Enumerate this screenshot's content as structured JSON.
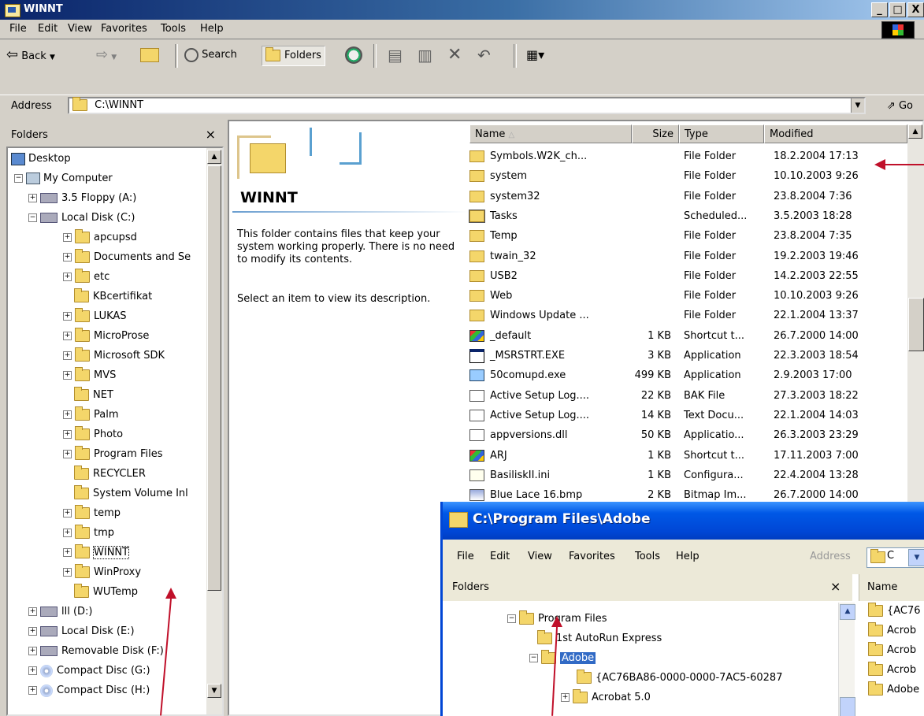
{
  "window": {
    "title": "WINNT",
    "min": "_",
    "max": "□",
    "close": "X"
  },
  "menu": [
    "File",
    "Edit",
    "View",
    "Favorites",
    "Tools",
    "Help"
  ],
  "toolbar": {
    "back": "Back",
    "search": "Search",
    "folders": "Folders"
  },
  "address": {
    "label": "Address",
    "value": "C:\\WINNT",
    "go": "Go"
  },
  "folders_pane": {
    "title": "Folders",
    "close": "×",
    "items": [
      {
        "label": "Desktop"
      },
      {
        "label": "My Computer"
      },
      {
        "label": "3.5 Floppy (A:)"
      },
      {
        "label": "Local Disk (C:)"
      },
      {
        "label": "apcupsd"
      },
      {
        "label": "Documents and Se"
      },
      {
        "label": "etc"
      },
      {
        "label": "KBcertifikat"
      },
      {
        "label": "LUKAS"
      },
      {
        "label": "MicroProse"
      },
      {
        "label": "Microsoft SDK"
      },
      {
        "label": "MVS"
      },
      {
        "label": "NET"
      },
      {
        "label": "Palm"
      },
      {
        "label": "Photo"
      },
      {
        "label": "Program Files"
      },
      {
        "label": "RECYCLER"
      },
      {
        "label": "System Volume Inl"
      },
      {
        "label": "temp"
      },
      {
        "label": "tmp"
      },
      {
        "label": "WINNT"
      },
      {
        "label": "WinProxy"
      },
      {
        "label": "WUTemp"
      },
      {
        "label": "lll (D:)"
      },
      {
        "label": "Local Disk (E:)"
      },
      {
        "label": "Removable Disk (F:)"
      },
      {
        "label": "Compact Disc (G:)"
      },
      {
        "label": "Compact Disc (H:)"
      }
    ]
  },
  "web_panel": {
    "title": "WINNT",
    "desc": "This folder contains files that keep your system working properly. There is no need to modify its contents.",
    "hint": "Select an item to view its description."
  },
  "columns": {
    "name": "Name",
    "size": "Size",
    "type": "Type",
    "modified": "Modified"
  },
  "files": [
    {
      "name": "Symbols.W2K_ch...",
      "size": "",
      "type": "File Folder",
      "modified": "18.2.2004 17:13",
      "icon": "folder"
    },
    {
      "name": "system",
      "size": "",
      "type": "File Folder",
      "modified": "10.10.2003 9:26",
      "icon": "folder"
    },
    {
      "name": "system32",
      "size": "",
      "type": "File Folder",
      "modified": "23.8.2004 7:36",
      "icon": "folder"
    },
    {
      "name": "Tasks",
      "size": "",
      "type": "Scheduled...",
      "modified": "3.5.2003 18:28",
      "icon": "tasks"
    },
    {
      "name": "Temp",
      "size": "",
      "type": "File Folder",
      "modified": "23.8.2004 7:35",
      "icon": "folder"
    },
    {
      "name": "twain_32",
      "size": "",
      "type": "File Folder",
      "modified": "19.2.2003 19:46",
      "icon": "folder"
    },
    {
      "name": "USB2",
      "size": "",
      "type": "File Folder",
      "modified": "14.2.2003 22:55",
      "icon": "folder"
    },
    {
      "name": "Web",
      "size": "",
      "type": "File Folder",
      "modified": "10.10.2003 9:26",
      "icon": "folder"
    },
    {
      "name": "Windows Update ...",
      "size": "",
      "type": "File Folder",
      "modified": "22.1.2004 13:37",
      "icon": "folder"
    },
    {
      "name": "_default",
      "size": "1 KB",
      "type": "Shortcut t...",
      "modified": "26.7.2000 14:00",
      "icon": "shortcut"
    },
    {
      "name": "_MSRSTRT.EXE",
      "size": "3 KB",
      "type": "Application",
      "modified": "22.3.2003 18:54",
      "icon": "app"
    },
    {
      "name": "50comupd.exe",
      "size": "499 KB",
      "type": "Application",
      "modified": "2.9.2003 17:00",
      "icon": "setup"
    },
    {
      "name": "Active Setup Log....",
      "size": "22 KB",
      "type": "BAK File",
      "modified": "27.3.2003 18:22",
      "icon": "file"
    },
    {
      "name": "Active Setup Log....",
      "size": "14 KB",
      "type": "Text Docu...",
      "modified": "22.1.2004 14:03",
      "icon": "text"
    },
    {
      "name": "appversions.dll",
      "size": "50 KB",
      "type": "Applicatio...",
      "modified": "26.3.2003 23:29",
      "icon": "dll"
    },
    {
      "name": "ARJ",
      "size": "1 KB",
      "type": "Shortcut t...",
      "modified": "17.11.2003 7:00",
      "icon": "shortcut"
    },
    {
      "name": "BasiliskII.ini",
      "size": "1 KB",
      "type": "Configura...",
      "modified": "22.4.2004 13:28",
      "icon": "ini"
    },
    {
      "name": "Blue Lace 16.bmp",
      "size": "2 KB",
      "type": "Bitmap Im...",
      "modified": "26.7.2000 14:00",
      "icon": "bmp"
    }
  ],
  "xp_window": {
    "title": "C:\\Program Files\\Adobe",
    "menu": [
      "File",
      "Edit",
      "View",
      "Favorites",
      "Tools",
      "Help"
    ],
    "address_label": "Address",
    "address_value": "C",
    "folders_title": "Folders",
    "close": "×",
    "name_col": "Name",
    "tree": [
      "Program Files",
      "1st AutoRun Express",
      "Adobe",
      "{AC76BA86-0000-0000-7AC5-60287",
      "Acrobat 5.0"
    ],
    "list": [
      "{AC76",
      "Acrob",
      "Acrob",
      "Acrob",
      "Adobe"
    ]
  }
}
